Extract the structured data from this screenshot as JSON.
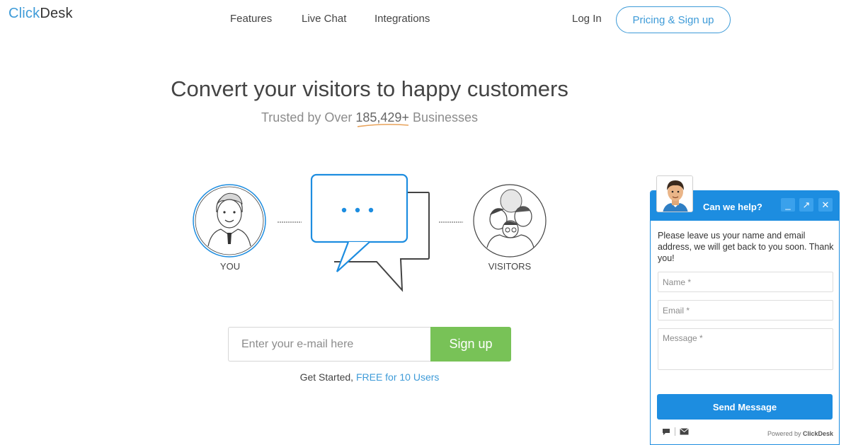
{
  "header": {
    "logo_part1": "Click",
    "logo_part2": "Desk",
    "nav": [
      "Features",
      "Live Chat",
      "Integrations"
    ],
    "login": "Log In",
    "pricing": "Pricing & Sign up"
  },
  "hero": {
    "title": "Convert your visitors to happy customers",
    "sub_prefix": "Trusted by Over ",
    "sub_count": "185,429+",
    "sub_suffix": " Businesses"
  },
  "illustration": {
    "you_label": "YOU",
    "visitors_label": "VISITORS"
  },
  "signup": {
    "email_placeholder": "Enter your e-mail here",
    "button": "Sign up",
    "started_prefix": "Get Started, ",
    "started_link": "FREE for 10 Users"
  },
  "widget": {
    "title": "Can we help?",
    "minimize": "_",
    "popout": "↗",
    "close": "✕",
    "message": "Please leave us your name and email address, we will get back to you soon. Thank you!",
    "name_placeholder": "Name *",
    "email_placeholder": "Email *",
    "message_placeholder": "Message *",
    "send": "Send Message",
    "powered_prefix": "Powered by ",
    "powered_brand": "ClickDesk"
  },
  "colors": {
    "brand_blue": "#3e9bd8",
    "widget_blue": "#1d8de0",
    "signup_green": "#78c257",
    "accent_orange": "#e8a25a"
  },
  "icons": [
    "chat-bubble-icon",
    "envelope-icon",
    "minimize-icon",
    "popout-icon",
    "close-icon"
  ]
}
